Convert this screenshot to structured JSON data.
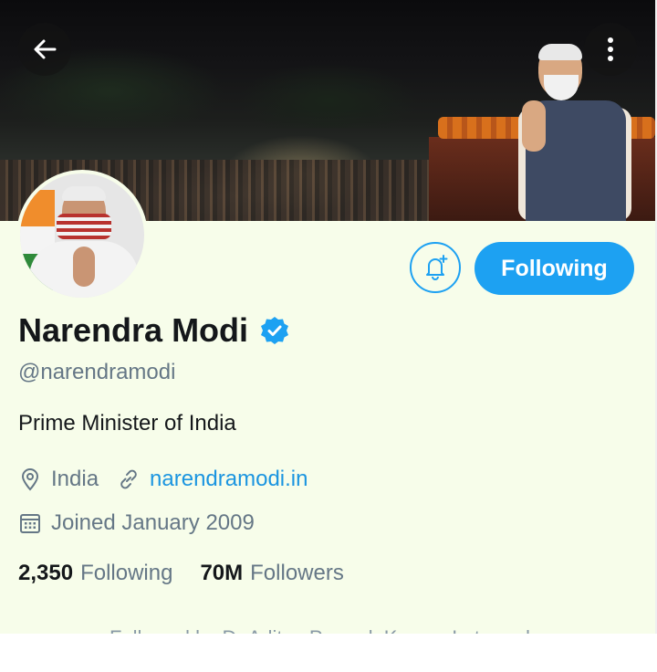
{
  "profile": {
    "name": "Narendra Modi",
    "handle": "@narendramodi",
    "bio": "Prime Minister of India",
    "location": "India",
    "website": "narendramodi.in",
    "joined": "Joined January 2009",
    "following_count": "2,350",
    "following_label": "Following",
    "followers_count": "70M",
    "followers_label": "Followers",
    "followed_by": "Followed by Dr Aditya Prasad, Kusum Lata and..."
  },
  "actions": {
    "follow_state_label": "Following",
    "notification_icon": "bell-plus-icon"
  },
  "topbar": {
    "back_icon": "arrow-left-icon",
    "more_icon": "more-vertical-icon"
  },
  "colors": {
    "accent": "#1da1f2",
    "link": "#1b95e0",
    "background": "#f7fdea",
    "secondary_text": "#657786",
    "primary_text": "#14171a"
  }
}
